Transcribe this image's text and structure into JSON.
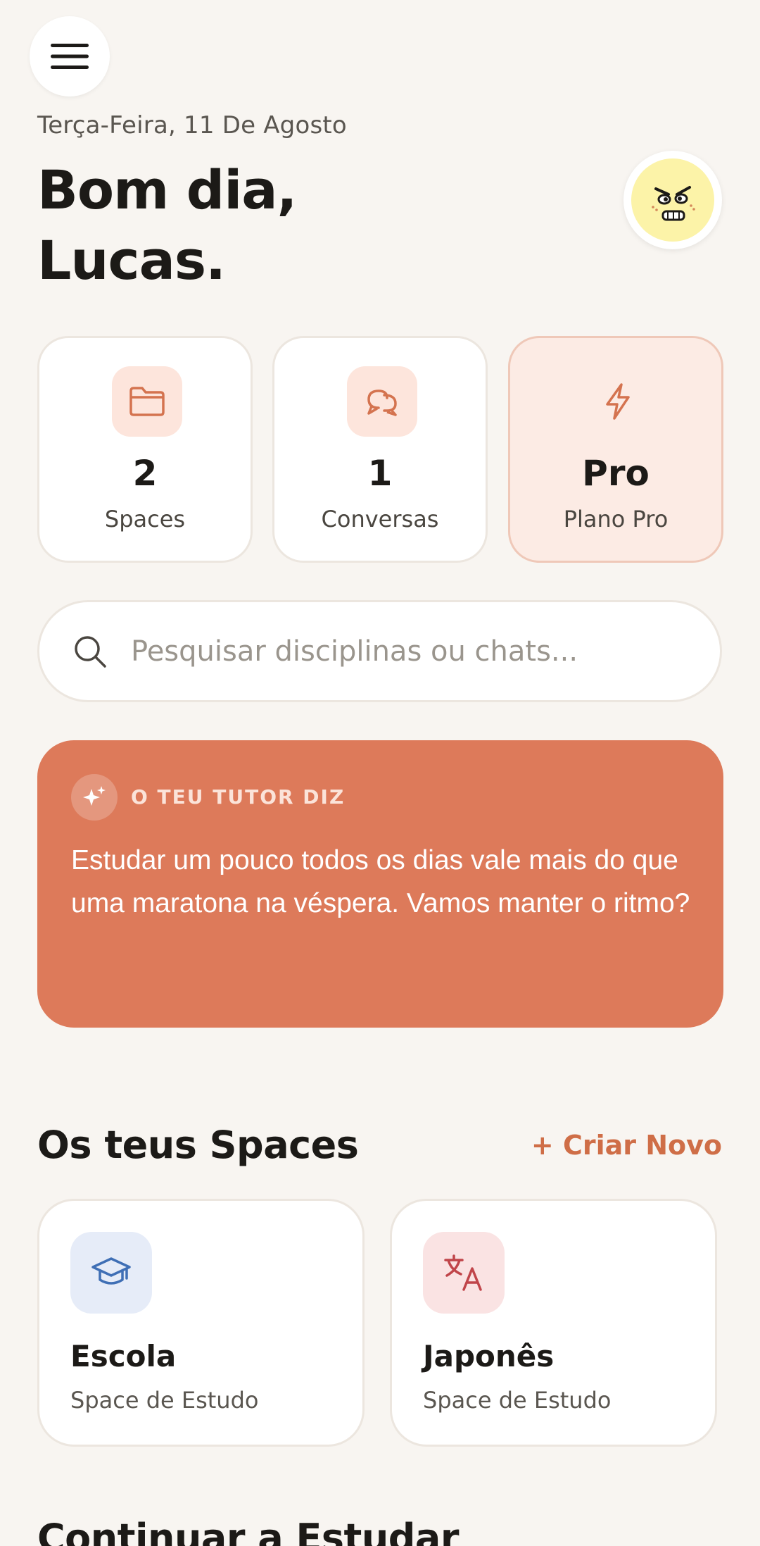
{
  "header": {
    "date": "Terça-Feira, 11 De Agosto",
    "greeting_line1": "Bom dia,",
    "greeting_line2": "Lucas."
  },
  "stats": [
    {
      "value": "2",
      "label": "Spaces",
      "icon": "folder-icon"
    },
    {
      "value": "1",
      "label": "Conversas",
      "icon": "chat-bubbles-icon"
    },
    {
      "value": "Pro",
      "label": "Plano Pro",
      "icon": "lightning-icon"
    }
  ],
  "search": {
    "placeholder": "Pesquisar disciplinas ou chats...",
    "value": ""
  },
  "tutor": {
    "label": "O TEU TUTOR DIZ",
    "message": "Estudar um pouco todos os dias vale mais do que uma maratona na véspera. Vamos manter o ritmo?"
  },
  "spaces_section": {
    "title": "Os teus Spaces",
    "create_label": "+ Criar Novo",
    "items": [
      {
        "name": "Escola",
        "subtitle": "Space de Estudo",
        "icon": "graduation-cap-icon",
        "icon_bg": "#e6ecf8",
        "icon_color": "#3f6fb5"
      },
      {
        "name": "Japonês",
        "subtitle": "Space de Estudo",
        "icon": "translate-icon",
        "icon_bg": "#fae3e3",
        "icon_color": "#c0454a"
      }
    ]
  },
  "continue_section": {
    "title": "Continuar a Estudar"
  },
  "colors": {
    "background": "#f8f5f1",
    "accent": "#dd7a5a",
    "accent_text": "#cf6e47",
    "pro_card_bg": "#fcebe4"
  }
}
